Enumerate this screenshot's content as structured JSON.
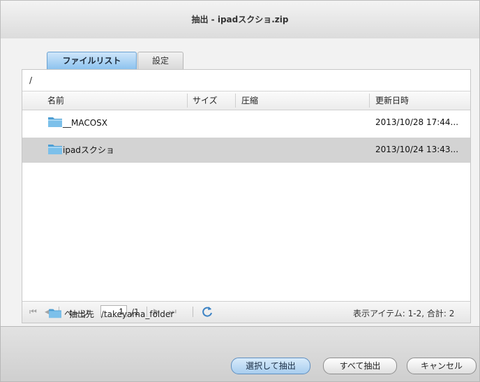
{
  "window": {
    "title": "抽出 - ipadスクショ.zip"
  },
  "tabs": [
    {
      "label": "ファイルリスト",
      "active": true
    },
    {
      "label": "設定",
      "active": false
    }
  ],
  "path": "/",
  "columns": {
    "name": "名前",
    "size": "サイズ",
    "compression": "圧縮",
    "modified": "更新日時"
  },
  "rows": [
    {
      "name": "__MACOSX",
      "size": "",
      "compression": "",
      "modified": "2013/10/28 17:44...",
      "selected": false,
      "icon": "folder-icon"
    },
    {
      "name": "ipadスクショ",
      "size": "",
      "compression": "",
      "modified": "2013/10/24 13:43...",
      "selected": true,
      "icon": "folder-icon"
    }
  ],
  "pager": {
    "page_label": "ページ",
    "page_value": "1",
    "page_total": "/1",
    "items_info": "表示アイテム: 1-2, 合計: 2"
  },
  "destination": {
    "label": "抽出先",
    "path": "/takeyama_folder"
  },
  "buttons": {
    "extract_selected": "選択して抽出",
    "extract_all": "すべて抽出",
    "cancel": "キャンセル"
  },
  "colors": {
    "accent": "#8dc3ef",
    "selection": "#d3d3d3",
    "folder": "#5aa7d8"
  }
}
